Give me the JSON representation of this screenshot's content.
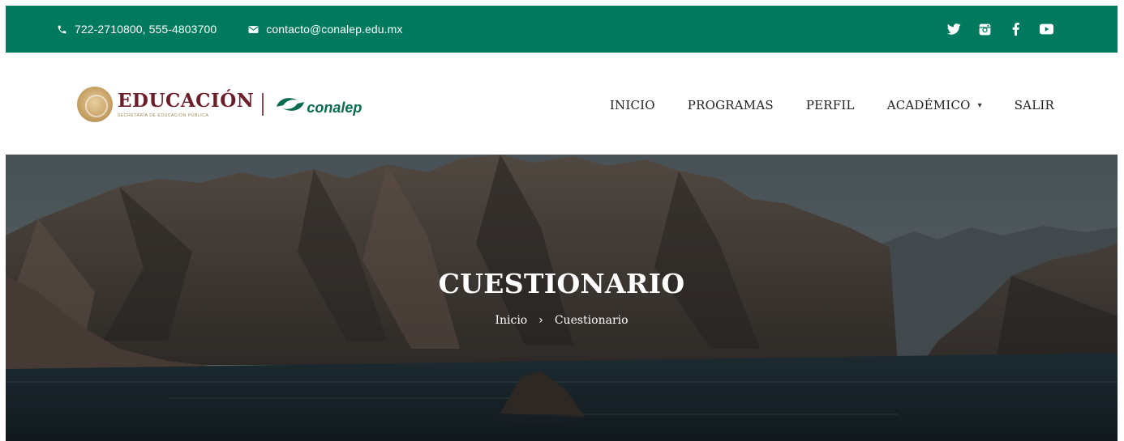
{
  "topbar": {
    "phone": "722-2710800, 555-4803700",
    "email": "contacto@conalep.edu.mx",
    "icons": [
      "phone-icon",
      "mail-icon"
    ],
    "social": [
      "twitter-icon",
      "instagram-icon",
      "facebook-icon",
      "youtube-icon"
    ],
    "background": "#007a5e"
  },
  "header": {
    "logo_title": "EDUCACIÓN",
    "logo_subtitle": "SECRETARÍA DE EDUCACIÓN PÚBLICA",
    "partner_logo": "conalep",
    "nav": [
      {
        "label": "INICIO"
      },
      {
        "label": "PROGRAMAS"
      },
      {
        "label": "PERFIL"
      },
      {
        "label": "ACADÉMICO"
      },
      {
        "label": "SALIR"
      }
    ]
  },
  "hero": {
    "title": "CUESTIONARIO",
    "breadcrumb": {
      "home": "Inicio",
      "separator": "›",
      "current": "Cuestionario"
    }
  }
}
